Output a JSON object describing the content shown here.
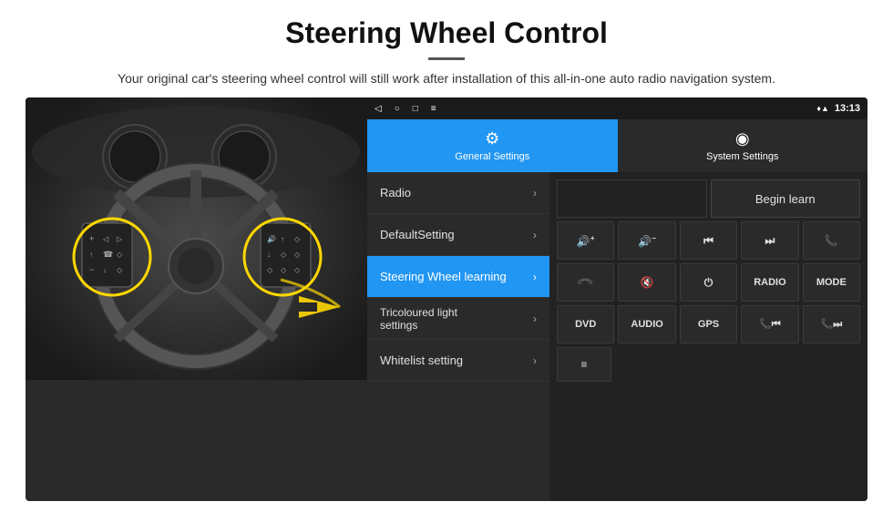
{
  "header": {
    "title": "Steering Wheel Control",
    "divider": true,
    "subtitle": "Your original car's steering wheel control will still work after installation of this all-in-one auto radio navigation system."
  },
  "android": {
    "status_bar": {
      "back_icon": "◁",
      "home_icon": "○",
      "square_icon": "□",
      "menu_icon": "≡",
      "location_icon": "♦",
      "signal_icon": "▲",
      "time": "13:13"
    },
    "tabs": [
      {
        "id": "general",
        "icon": "⚙",
        "label": "General Settings",
        "active": true
      },
      {
        "id": "system",
        "icon": "◉",
        "label": "System Settings",
        "active": false
      }
    ],
    "menu_items": [
      {
        "id": "radio",
        "label": "Radio",
        "active": false
      },
      {
        "id": "default",
        "label": "DefaultSetting",
        "active": false
      },
      {
        "id": "steering",
        "label": "Steering Wheel learning",
        "active": true
      },
      {
        "id": "tricoloured",
        "label": "Tricoloured light settings",
        "active": false
      },
      {
        "id": "whitelist",
        "label": "Whitelist setting",
        "active": false
      }
    ],
    "controls": {
      "begin_learn": "Begin learn",
      "row1": [
        "🔊+",
        "🔊−",
        "⏮",
        "⏭",
        "📞"
      ],
      "row1_labels": [
        "vol+",
        "vol-",
        "prev",
        "next",
        "call"
      ],
      "row2": [
        "↩",
        "🔊✕",
        "⏻",
        "RADIO",
        "MODE"
      ],
      "row3": [
        "DVD",
        "AUDIO",
        "GPS",
        "📞⏮",
        "📞⏭"
      ],
      "row4_icon": "≡"
    }
  }
}
